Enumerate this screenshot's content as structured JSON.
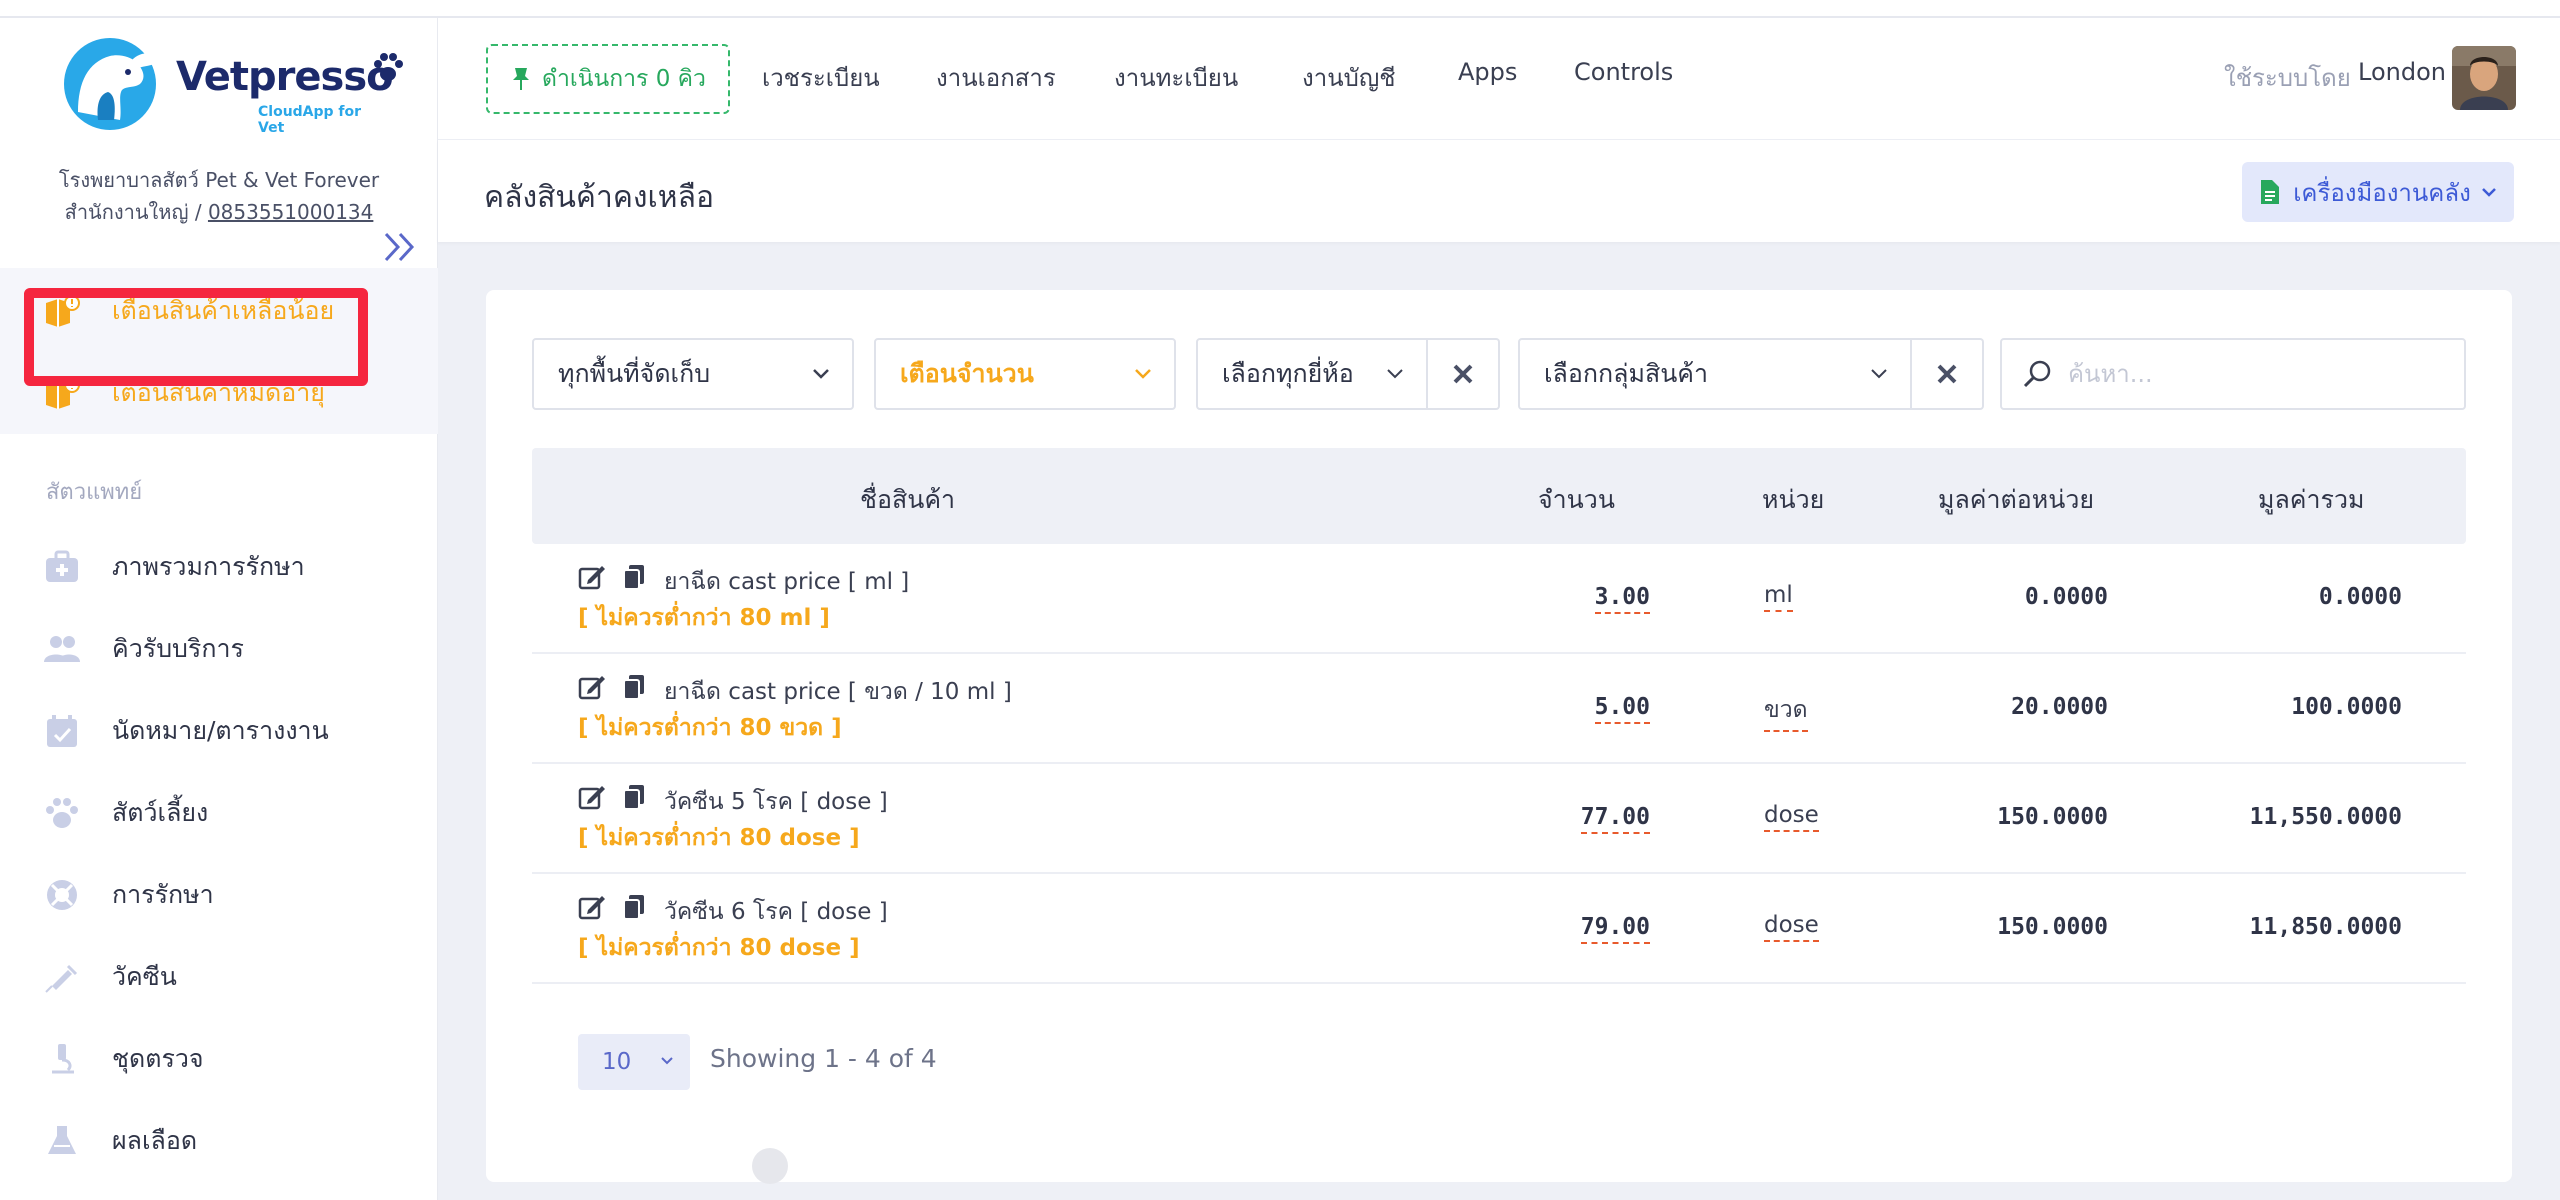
{
  "brand": {
    "name": "Vetpresso",
    "tagline": "CloudApp for Vet"
  },
  "clinic": {
    "name": "โรงพยาบาลสัตว์ Pet & Vet Forever",
    "branch_prefix": "สำนักงานใหญ่ / ",
    "phone": "0853551000134"
  },
  "sidebar": {
    "alerts": [
      {
        "label": "เตือนสินค้าเหลือน้อย",
        "icon": "box-alert-icon"
      },
      {
        "label": "เตือนสินค้าหมดอายุ",
        "icon": "box-alert-icon"
      }
    ],
    "section_label": "สัตวแพทย์",
    "items": [
      {
        "label": "ภาพรวมการรักษา",
        "icon": "medical-kit-icon"
      },
      {
        "label": "คิวรับบริการ",
        "icon": "users-icon"
      },
      {
        "label": "นัดหมาย/ตารางงาน",
        "icon": "calendar-check-icon"
      },
      {
        "label": "สัตว์เลี้ยง",
        "icon": "paw-icon"
      },
      {
        "label": "การรักษา",
        "icon": "lifebuoy-icon"
      },
      {
        "label": "วัคซีน",
        "icon": "syringe-icon"
      },
      {
        "label": "ชุดตรวจ",
        "icon": "microscope-icon"
      },
      {
        "label": "ผลเลือด",
        "icon": "flask-icon"
      }
    ]
  },
  "header": {
    "queue_label": "ดำเนินการ 0 คิว",
    "nav": [
      "เวชระเบียน",
      "งานเอกสาร",
      "งานทะเบียน",
      "งานบัญชี",
      "Apps",
      "Controls"
    ],
    "user_label": "ใช้ระบบโดย",
    "user_name": "London"
  },
  "page": {
    "title": "คลังสินค้าคงเหลือ",
    "tools_label": "เครื่องมืองานคลัง"
  },
  "filters": {
    "location": "ทุกพื้นที่จัดเก็บ",
    "alert_type": "เตือนจำนวน",
    "brand": "เลือกทุกยี่ห้อ",
    "group": "เลือกกลุ่มสินค้า",
    "search_placeholder": "ค้นหา..."
  },
  "table": {
    "headers": [
      "ชื่อสินค้า",
      "จำนวน",
      "หน่วย",
      "มูลค่าต่อหน่วย",
      "มูลค่ารวม"
    ],
    "rows": [
      {
        "name": "ยาฉีด cast price [ ml ]",
        "warn": "[ ไม่ควรต่ำกว่า 80 ml ]",
        "qty": "3.00",
        "unit": "ml",
        "unit_price": "0.0000",
        "total": "0.0000"
      },
      {
        "name": "ยาฉีด cast price [ ขวด / 10 ml ]",
        "warn": "[ ไม่ควรต่ำกว่า 80 ขวด ]",
        "qty": "5.00",
        "unit": "ขวด",
        "unit_price": "20.0000",
        "total": "100.0000"
      },
      {
        "name": "วัคซีน 5 โรค [ dose ]",
        "warn": "[ ไม่ควรต่ำกว่า 80 dose ]",
        "qty": "77.00",
        "unit": "dose",
        "unit_price": "150.0000",
        "total": "11,550.0000"
      },
      {
        "name": "วัคซีน 6 โรค [ dose ]",
        "warn": "[ ไม่ควรต่ำกว่า 80 dose ]",
        "qty": "79.00",
        "unit": "dose",
        "unit_price": "150.0000",
        "total": "11,850.0000"
      }
    ]
  },
  "pagination": {
    "page_size": "10",
    "showing": "Showing 1 - 4 of 4"
  },
  "colors": {
    "accent": "#3d5ad6",
    "warning": "#f6a81c",
    "success": "#27a85d",
    "highlight": "#f5263f"
  }
}
